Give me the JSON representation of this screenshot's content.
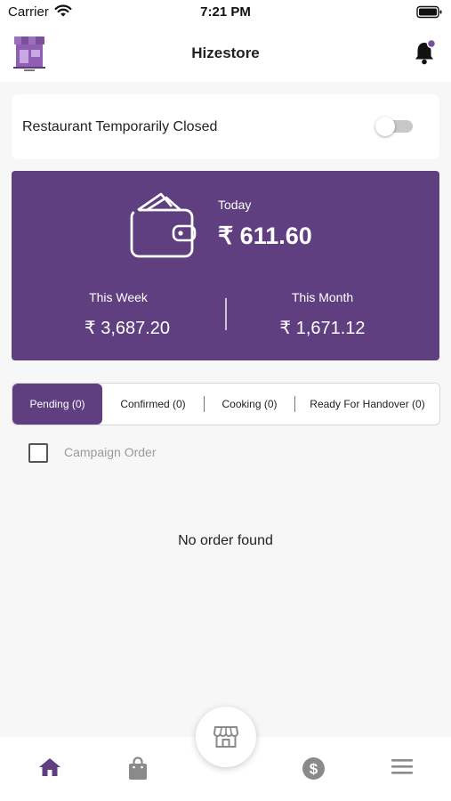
{
  "status_bar": {
    "carrier": "Carrier",
    "time": "7:21 PM"
  },
  "header": {
    "title": "Hizestore",
    "logo_icon": "store-logo",
    "notification_icon": "bell-icon"
  },
  "restaurant_status": {
    "label": "Restaurant Temporarily Closed",
    "toggle_on": false
  },
  "earnings": {
    "today_label": "Today",
    "today_amount": "₹ 611.60",
    "week_label": "This Week",
    "week_amount": "₹ 3,687.20",
    "month_label": "This Month",
    "month_amount": "₹ 1,671.12"
  },
  "tabs": [
    {
      "label": "Pending (0)",
      "active": true
    },
    {
      "label": "Confirmed (0)",
      "active": false
    },
    {
      "label": "Cooking (0)",
      "active": false
    },
    {
      "label": "Ready For Handover (0)",
      "active": false
    }
  ],
  "campaign_filter": {
    "label": "Campaign Order",
    "checked": false
  },
  "empty_state": {
    "message": "No order found"
  },
  "bottom_nav": {
    "items": [
      "home-icon",
      "bag-icon",
      "store-icon",
      "dollar-icon",
      "menu-icon"
    ],
    "active": "home-icon"
  },
  "colors": {
    "primary": "#5f3f7f",
    "background": "#f7f7f7",
    "inactive_icon": "#8a8a8a"
  }
}
